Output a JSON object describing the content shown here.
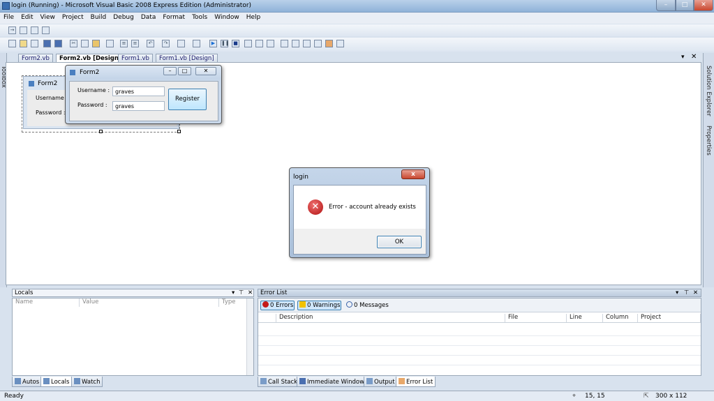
{
  "window": {
    "title": "login (Running) - Microsoft Visual Basic 2008 Express Edition (Administrator)"
  },
  "menu": {
    "items": [
      "File",
      "Edit",
      "View",
      "Project",
      "Build",
      "Debug",
      "Data",
      "Format",
      "Tools",
      "Window",
      "Help"
    ]
  },
  "tabs": [
    {
      "label": "Form2.vb"
    },
    {
      "label": "Form2.vb [Design]"
    },
    {
      "label": "Form1.vb"
    },
    {
      "label": "Form1.vb [Design]"
    }
  ],
  "side": {
    "toolbox": "Toolbox",
    "solution_explorer": "Solution Explorer",
    "properties": "Properties"
  },
  "designer_form": {
    "title": "Form2",
    "username_label": "Username :",
    "password_label": "Password :"
  },
  "running_form": {
    "title": "Form2",
    "username_label": "Username :",
    "password_label": "Password :",
    "username_value": "graves",
    "password_value": "graves",
    "register_button": "Register"
  },
  "dialog": {
    "title": "login",
    "message": "Error - account already exists",
    "ok_button": "OK",
    "close_glyph": "x"
  },
  "locals": {
    "title": "Locals",
    "columns": [
      "Name",
      "Value",
      "Type"
    ]
  },
  "error_list": {
    "title": "Error List",
    "errors": "0 Errors",
    "warnings": "0 Warnings",
    "messages": "0 Messages",
    "columns": [
      "Description",
      "File",
      "Line",
      "Column",
      "Project"
    ]
  },
  "bottom_tabs_left": [
    "Autos",
    "Locals",
    "Watch"
  ],
  "bottom_tabs_right": [
    "Call Stack",
    "Immediate Window",
    "Output",
    "Error List"
  ],
  "status": {
    "text": "Ready",
    "position": "15, 15",
    "size": "300 x 112"
  },
  "colors": {
    "accent": "#3b6fb0",
    "error": "#c41a1a",
    "warning": "#f2c200"
  }
}
